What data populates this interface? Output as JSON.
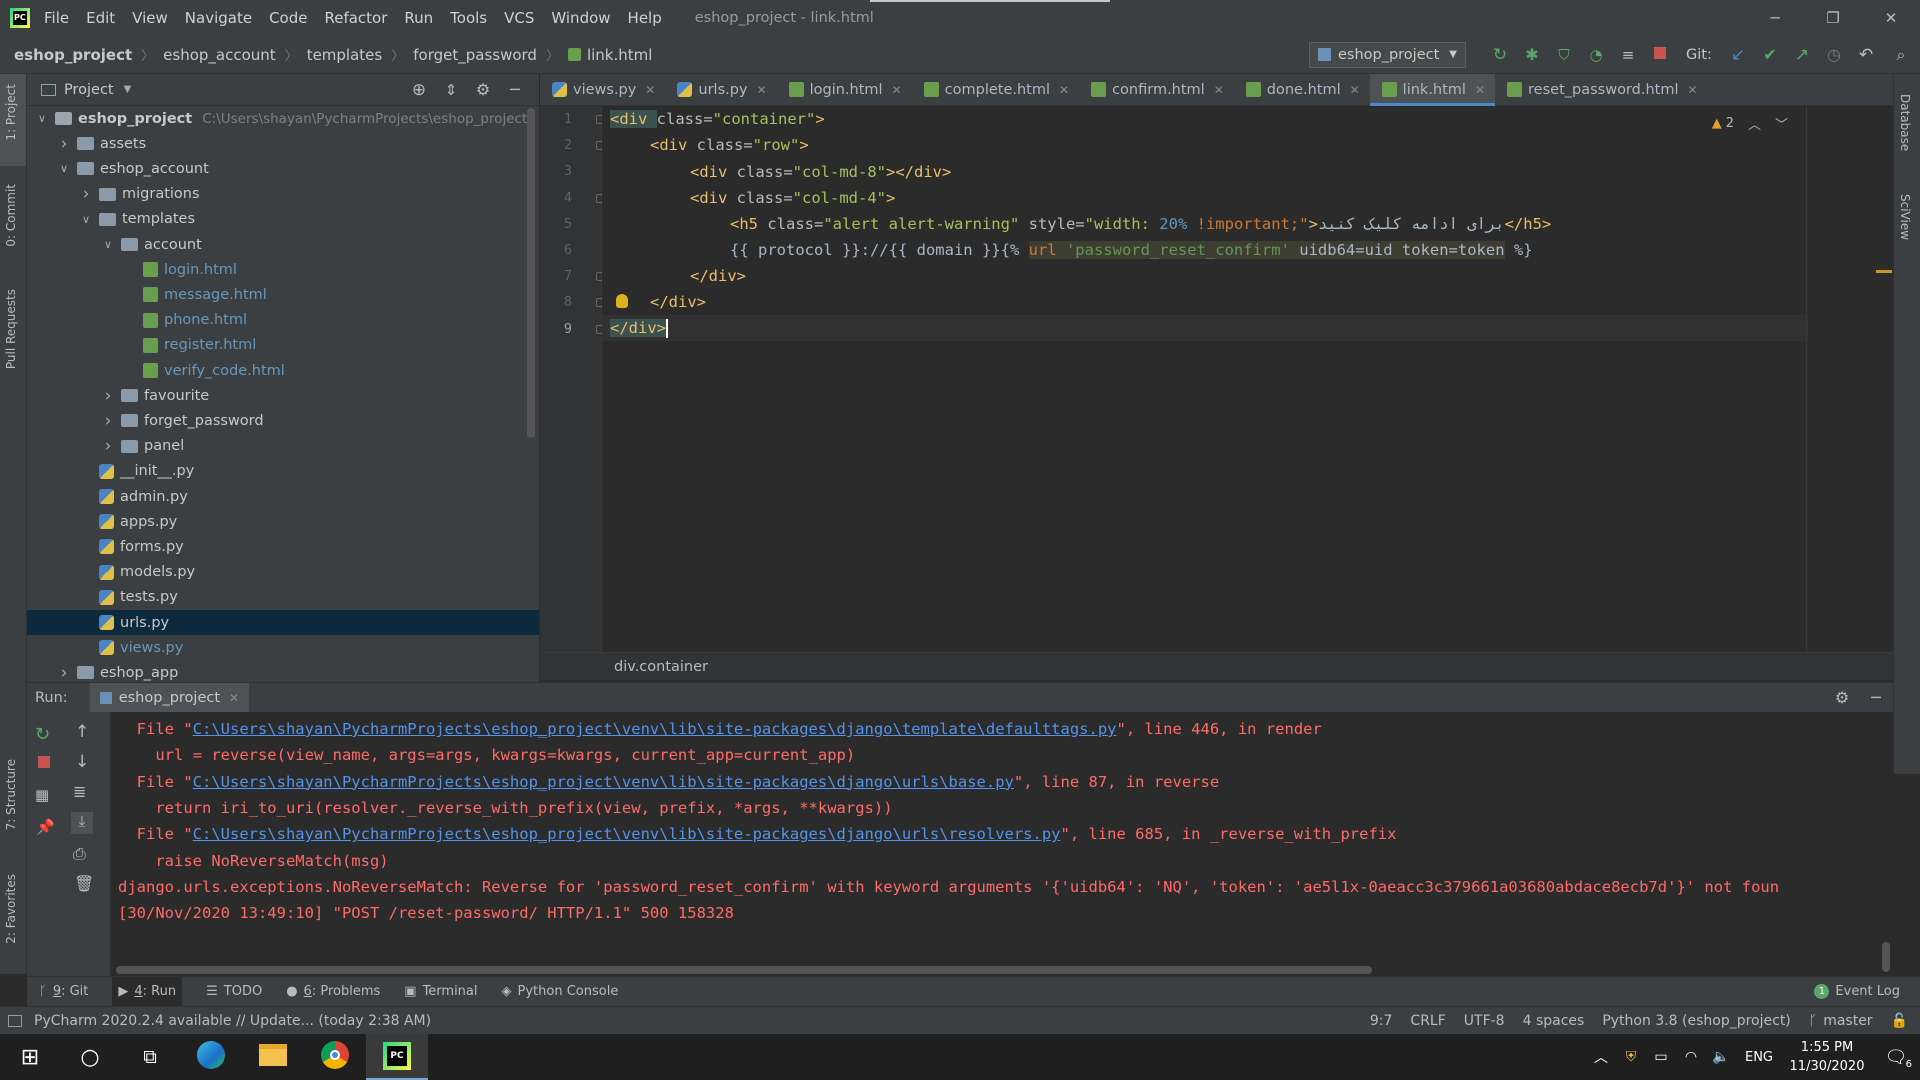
{
  "menu": {
    "items": [
      "File",
      "Edit",
      "View",
      "Navigate",
      "Code",
      "Refactor",
      "Run",
      "Tools",
      "VCS",
      "Window",
      "Help"
    ],
    "window_title": "eshop_project - link.html"
  },
  "breadcrumb": [
    "eshop_project",
    "eshop_account",
    "templates",
    "forget_password",
    "link.html"
  ],
  "run_config": "eshop_project",
  "git_label": "Git:",
  "project_panel": {
    "title": "Project"
  },
  "tree": [
    {
      "label": "eshop_project",
      "path": "C:\\Users\\shayan\\PycharmProjects\\eshop_project",
      "type": "project",
      "depth": 0,
      "arrow": "open"
    },
    {
      "label": "assets",
      "type": "folder",
      "depth": 1,
      "arrow": "closed"
    },
    {
      "label": "eshop_account",
      "type": "folder",
      "depth": 1,
      "arrow": "open"
    },
    {
      "label": "migrations",
      "type": "folder",
      "depth": 2,
      "arrow": "closed"
    },
    {
      "label": "templates",
      "type": "folder",
      "depth": 2,
      "arrow": "open"
    },
    {
      "label": "account",
      "type": "folder",
      "depth": 3,
      "arrow": "open"
    },
    {
      "label": "login.html",
      "type": "html",
      "depth": 4
    },
    {
      "label": "message.html",
      "type": "html",
      "depth": 4
    },
    {
      "label": "phone.html",
      "type": "html",
      "depth": 4
    },
    {
      "label": "register.html",
      "type": "html",
      "depth": 4
    },
    {
      "label": "verify_code.html",
      "type": "html",
      "depth": 4
    },
    {
      "label": "favourite",
      "type": "folder",
      "depth": 3,
      "arrow": "closed"
    },
    {
      "label": "forget_password",
      "type": "folder",
      "depth": 3,
      "arrow": "closed"
    },
    {
      "label": "panel",
      "type": "folder",
      "depth": 3,
      "arrow": "closed"
    },
    {
      "label": "__init__.py",
      "type": "py",
      "depth": 2
    },
    {
      "label": "admin.py",
      "type": "py",
      "depth": 2
    },
    {
      "label": "apps.py",
      "type": "py",
      "depth": 2
    },
    {
      "label": "forms.py",
      "type": "py",
      "depth": 2
    },
    {
      "label": "models.py",
      "type": "py",
      "depth": 2
    },
    {
      "label": "tests.py",
      "type": "py",
      "depth": 2
    },
    {
      "label": "urls.py",
      "type": "py",
      "depth": 2,
      "selected": true
    },
    {
      "label": "views.py",
      "type": "py",
      "depth": 2
    },
    {
      "label": "eshop_app",
      "type": "folder",
      "depth": 1,
      "arrow": "closed"
    }
  ],
  "tabs": [
    {
      "label": "views.py",
      "type": "py"
    },
    {
      "label": "urls.py",
      "type": "py"
    },
    {
      "label": "login.html",
      "type": "html"
    },
    {
      "label": "complete.html",
      "type": "html"
    },
    {
      "label": "confirm.html",
      "type": "html"
    },
    {
      "label": "done.html",
      "type": "html"
    },
    {
      "label": "link.html",
      "type": "html",
      "active": true
    },
    {
      "label": "reset_password.html",
      "type": "html"
    }
  ],
  "editor": {
    "line_numbers": [
      "1",
      "2",
      "3",
      "4",
      "5",
      "6",
      "7",
      "8",
      "9"
    ],
    "warning_count": "2",
    "l1": {
      "a": "<div ",
      "b": "class=",
      "c": "\"container\"",
      "d": ">"
    },
    "l2": {
      "a": "<div ",
      "b": "class=",
      "c": "\"row\"",
      "d": ">"
    },
    "l3": {
      "a": "<div ",
      "b": "class=",
      "c": "\"col-md-8\"",
      "d": "></div>"
    },
    "l4": {
      "a": "<div ",
      "b": "class=",
      "c": "\"col-md-4\"",
      "d": ">"
    },
    "l5": {
      "a": "<h5 ",
      "b": "class=",
      "c": "\"alert alert-warning\"",
      "d": " style=",
      "e": "\"width: ",
      "f": "20%",
      "g": " !important;\"",
      "h": ">",
      "i": "برای ادامه کلیک کنید",
      "j": "</h5>"
    },
    "l6": {
      "a": "{{ protocol }}://{{ domain }}{% ",
      "b": "url ",
      "c": "'password_reset_confirm'",
      "d": " uidb64=uid token=token",
      "e": " %}"
    },
    "l7": "</div>",
    "l8": "</div>",
    "l9": "</div>"
  },
  "editor_breadcrumb": "div.container",
  "run": {
    "label": "Run:",
    "tab": "eshop_project"
  },
  "console": [
    {
      "pre": "  File \"",
      "link": "C:\\Users\\shayan\\PycharmProjects\\eshop_project\\venv\\lib\\site-packages\\django\\template\\defaulttags.py",
      "post": "\", line 446, in render"
    },
    {
      "pre": "    url = reverse(view_name, args=args, kwargs=kwargs, current_app=current_app)"
    },
    {
      "pre": "  File \"",
      "link": "C:\\Users\\shayan\\PycharmProjects\\eshop_project\\venv\\lib\\site-packages\\django\\urls\\base.py",
      "post": "\", line 87, in reverse"
    },
    {
      "pre": "    return iri_to_uri(resolver._reverse_with_prefix(view, prefix, *args, **kwargs))"
    },
    {
      "pre": "  File \"",
      "link": "C:\\Users\\shayan\\PycharmProjects\\eshop_project\\venv\\lib\\site-packages\\django\\urls\\resolvers.py",
      "post": "\", line 685, in _reverse_with_prefix"
    },
    {
      "pre": "    raise NoReverseMatch(msg)"
    },
    {
      "pre": "django.urls.exceptions.NoReverseMatch: Reverse for 'password_reset_confirm' with keyword arguments '{'uidb64': 'NQ', 'token': 'ae5l1x-0aeacc3c379661a03680abdace8ecb7d'}' not foun"
    },
    {
      "pre": "[30/Nov/2020 13:49:10] \"POST /reset-password/ HTTP/1.1\" 500 158328"
    }
  ],
  "toolwindows": [
    {
      "key": "9",
      "label": ": Git"
    },
    {
      "key": "4",
      "label": ": Run"
    },
    {
      "key": "",
      "label": "TODO"
    },
    {
      "key": "6",
      "label": ": Problems"
    },
    {
      "key": "",
      "label": "Terminal"
    },
    {
      "key": "",
      "label": "Python Console"
    }
  ],
  "event_log": "Event Log",
  "event_count": "1",
  "status": {
    "message": "PyCharm 2020.2.4 available // Update... (today 2:38 AM)",
    "position": "9:7",
    "line_sep": "CRLF",
    "encoding": "UTF-8",
    "indent": "4 spaces",
    "interpreter": "Python 3.8 (eshop_project)",
    "branch": "master"
  },
  "side_labels": {
    "project": "1: Project",
    "commit": "0: Commit",
    "pull": "Pull Requests",
    "structure": "7: Structure",
    "favorites": "2: Favorites",
    "database": "Database",
    "sciview": "SciView"
  },
  "taskbar": {
    "lang": "ENG",
    "time": "1:55 PM",
    "date": "11/30/2020",
    "notif": "6"
  }
}
